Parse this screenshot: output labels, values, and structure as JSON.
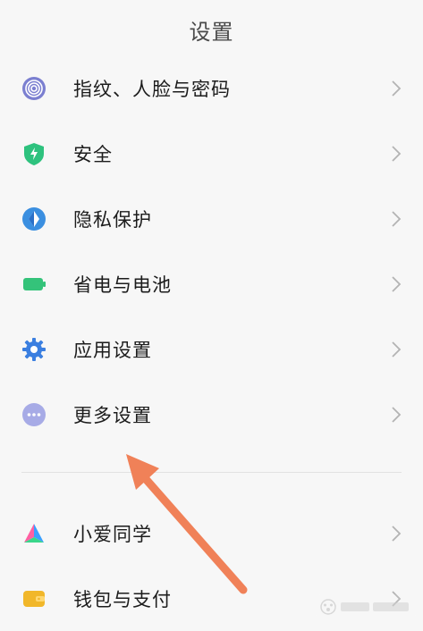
{
  "header": {
    "title": "设置"
  },
  "group1": [
    {
      "label": "指纹、人脸与密码",
      "icon": "fingerprint-icon",
      "color": "#7b7fd0"
    },
    {
      "label": "安全",
      "icon": "shield-icon",
      "color": "#2ec27e"
    },
    {
      "label": "隐私保护",
      "icon": "privacy-icon",
      "color": "#3b8fe0"
    },
    {
      "label": "省电与电池",
      "icon": "battery-icon",
      "color": "#34c37a"
    },
    {
      "label": "应用设置",
      "icon": "gear-icon",
      "color": "#3b7fe0"
    },
    {
      "label": "更多设置",
      "icon": "more-icon",
      "color": "#8d8fd8"
    }
  ],
  "group2": [
    {
      "label": "小爱同学",
      "icon": "xiaoai-icon",
      "color": "#3aa0ff"
    },
    {
      "label": "钱包与支付",
      "icon": "wallet-icon",
      "color": "#f1b72a"
    }
  ],
  "annotation": {
    "arrow_color": "#f08158"
  }
}
